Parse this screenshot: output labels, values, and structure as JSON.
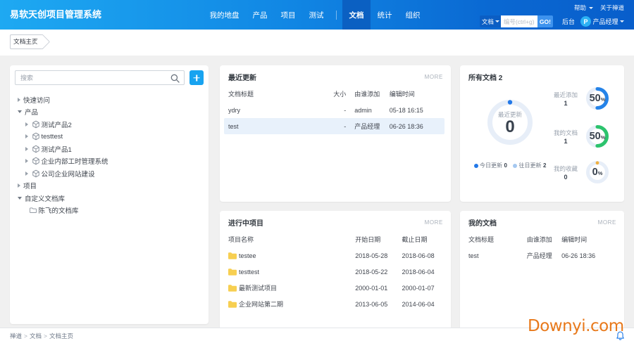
{
  "header": {
    "brand": "易软天创项目管理系统",
    "nav": [
      {
        "label": "我的地盘",
        "active": false
      },
      {
        "label": "产品",
        "active": false
      },
      {
        "label": "项目",
        "active": false
      },
      {
        "label": "测试",
        "active": false
      },
      {
        "label": "文档",
        "active": true
      },
      {
        "label": "统计",
        "active": false
      },
      {
        "label": "组织",
        "active": false
      }
    ],
    "top_links": {
      "help": "帮助",
      "about": "关于禅道"
    },
    "search": {
      "scope": "文档",
      "placeholder": "编号(ctrl+g)",
      "go": "GO!"
    },
    "admin": "后台",
    "user": {
      "avatar": "P",
      "name": "产品经理"
    }
  },
  "tabbar": {
    "tab": "文档主页"
  },
  "sidebar": {
    "search_placeholder": "搜索",
    "tree": [
      {
        "label": "快速访问",
        "level": 0,
        "caret": "collapsed",
        "icon": ""
      },
      {
        "label": "产品",
        "level": 0,
        "caret": "expanded",
        "icon": ""
      },
      {
        "label": "测试产品2",
        "level": 1,
        "caret": "collapsed",
        "icon": "cube"
      },
      {
        "label": "testtest",
        "level": 1,
        "caret": "collapsed",
        "icon": "cube"
      },
      {
        "label": "测试产品1",
        "level": 1,
        "caret": "collapsed",
        "icon": "cube"
      },
      {
        "label": "企业内部工时管理系统",
        "level": 1,
        "caret": "collapsed",
        "icon": "cube"
      },
      {
        "label": "公司企业网站建设",
        "level": 1,
        "caret": "collapsed",
        "icon": "cube"
      },
      {
        "label": "项目",
        "level": 0,
        "caret": "collapsed",
        "icon": ""
      },
      {
        "label": "自定义文档库",
        "level": 0,
        "caret": "expanded",
        "icon": ""
      },
      {
        "label": "陈飞的文档库",
        "level": 1,
        "caret": "none",
        "icon": "folder-outline"
      }
    ]
  },
  "recent_updates": {
    "title": "最近更新",
    "more": "MORE",
    "columns": [
      "文档标题",
      "大小",
      "由谁添加",
      "编辑时间"
    ],
    "rows": [
      {
        "title": "ydry",
        "size": "-",
        "added_by": "admin",
        "edited": "05-18 16:15",
        "highlight": false
      },
      {
        "title": "test",
        "size": "-",
        "added_by": "产品经理",
        "edited": "06-26 18:36",
        "highlight": true
      }
    ]
  },
  "all_docs": {
    "title": "所有文档",
    "count": "2",
    "gauge": {
      "label": "最近更新",
      "value": "0",
      "ring_color": "#e7eef8",
      "dot_color": "#2278e8"
    },
    "legend": [
      {
        "label": "今日更新",
        "value": "0",
        "color": "#2278e8"
      },
      {
        "label": "往日更新",
        "value": "2",
        "color": "#a5c8f0"
      }
    ],
    "stats": [
      {
        "label": "最近添加",
        "value": "1",
        "number": "50",
        "unit": "%",
        "percent": 50,
        "color": "#2583e8"
      },
      {
        "label": "我的文档",
        "value": "1",
        "number": "50",
        "unit": "%",
        "percent": 50,
        "color": "#2cc36d"
      },
      {
        "label": "我的收藏",
        "value": "0",
        "number": "0",
        "unit": "%",
        "percent": 0,
        "color": "#efb041"
      }
    ]
  },
  "ongoing_projects": {
    "title": "进行中项目",
    "more": "MORE",
    "columns": [
      "项目名称",
      "开始日期",
      "截止日期"
    ],
    "rows": [
      {
        "name": "testee",
        "start": "2018-05-28",
        "end": "2018-06-08"
      },
      {
        "name": "testtest",
        "start": "2018-05-22",
        "end": "2018-06-04"
      },
      {
        "name": "最新测试项目",
        "start": "2000-01-01",
        "end": "2000-01-07"
      },
      {
        "name": "企业网站第二期",
        "start": "2013-06-05",
        "end": "2014-06-04"
      }
    ]
  },
  "my_docs": {
    "title": "我的文档",
    "more": "MORE",
    "columns": [
      "文档标题",
      "由谁添加",
      "编辑时间"
    ],
    "rows": [
      {
        "title": "test",
        "added_by": "产品经理",
        "edited": "06-26 18:36"
      }
    ]
  },
  "footer": {
    "breadcrumb": [
      "禅道",
      "文档",
      "文档主页"
    ]
  },
  "watermark": "Downyi.com",
  "colors": {
    "header_gradient_start": "#1ea9f2",
    "header_gradient_end": "#085ecb",
    "nav_active_bg": "#0b60c2",
    "accent_blue": "#2278e8",
    "accent_green": "#2cc36d",
    "accent_amber": "#efb041",
    "highlight_row": "#e8f1fb",
    "content_bg": "#f0f0f0",
    "folder_yellow": "#f7cf51",
    "watermark_orange": "#e8791b"
  }
}
